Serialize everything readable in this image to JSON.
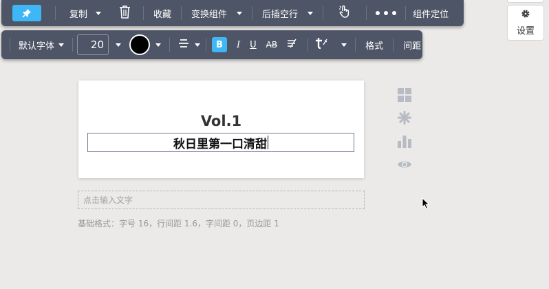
{
  "toolbar_main": {
    "copy_label": "复制",
    "collect_label": "收藏",
    "switch_component_label": "变换组件",
    "insert_blank_label": "后插空行",
    "locate_label": "组件定位"
  },
  "toolbar_format": {
    "font_family": "默认字体",
    "font_size": "20",
    "bold_label": "B",
    "italic_label": "I",
    "underline_label": "U",
    "strike_label": "AB",
    "format_label": "格式",
    "spacing_label": "间距",
    "text_color": "#000000",
    "accent_color": "#3fb6f5"
  },
  "settings": {
    "label": "设置"
  },
  "document": {
    "volume": "Vol.1",
    "title": "秋日里第一口清甜"
  },
  "input": {
    "placeholder": "点击输入文字"
  },
  "caption": "基础格式：字号 16，行间距 1.6，字间距 0，页边距 1",
  "icons": [
    "pin-icon",
    "trash-icon",
    "pointer-hand-icon",
    "more-icon",
    "gear-icon",
    "grid-icon",
    "sparkle-icon",
    "bar-chart-icon",
    "eye-icon"
  ]
}
